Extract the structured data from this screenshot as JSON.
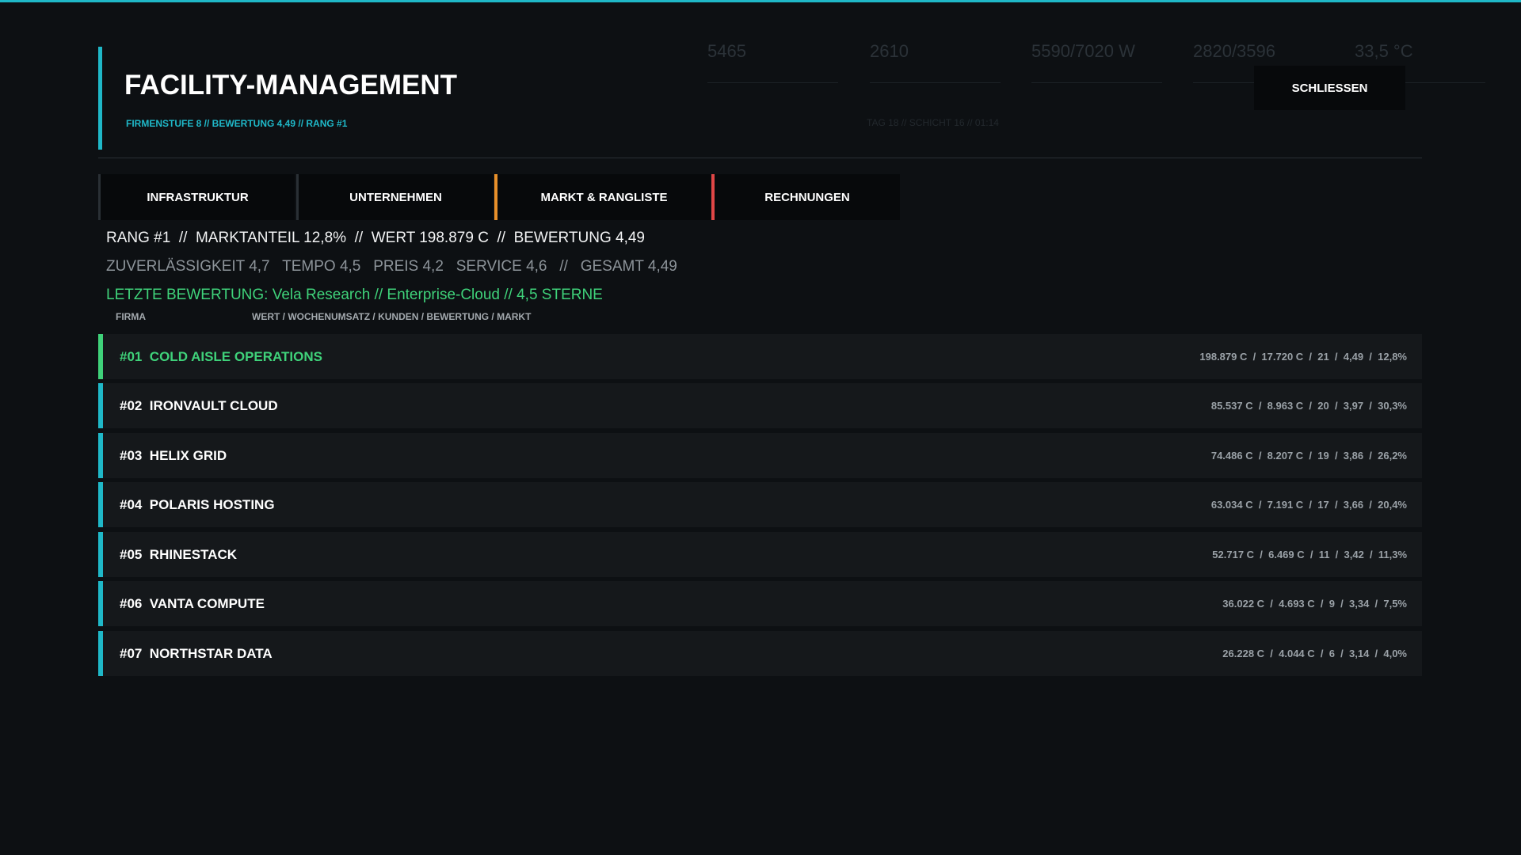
{
  "colors": {
    "accent": "#1fb8c8",
    "top_rank": "#3fd27a",
    "tab_markt": "#e8902a",
    "tab_rechnungen": "#e04646"
  },
  "header": {
    "title": "FACILITY-MANAGEMENT",
    "subtitle": "FIRMENSTUFE 8 // BEWERTUNG 4,49 // RANG #1",
    "close_label": "SCHLIESSEN"
  },
  "background_hud": {
    "values": [
      "5465",
      "2610",
      "5590/7020 W",
      "2820/3596",
      "33,5 °C"
    ],
    "day_line": "TAG 18 // SCHICHT 16 // 01:14"
  },
  "tabs": [
    {
      "label": "INFRASTRUKTUR",
      "icon": "none"
    },
    {
      "label": "UNTERNEHMEN"
    },
    {
      "label": "MARKT & RANGLISTE"
    },
    {
      "label": "RECHNUNGEN"
    }
  ],
  "summary": {
    "line1": "RANG #1  //  MARKTANTEIL 12,8%  //  WERT 198.879 C  //  BEWERTUNG 4,49",
    "line2": "ZUVERLÄSSIGKEIT 4,7   TEMPO 4,5   PREIS 4,2   SERVICE 4,6   //   GESAMT 4,49",
    "line3": "LETZTE BEWERTUNG: Vela Research // Enterprise-Cloud // 4,5 STERNE"
  },
  "columns": {
    "firma": "FIRMA",
    "stats": "WERT / WOCHENUMSATZ / KUNDEN / BEWERTUNG / MARKT"
  },
  "rows": [
    {
      "name": "#01  COLD AISLE OPERATIONS",
      "stats": "198.879 C  /  17.720 C  /  21  /  4,49  /  12,8%"
    },
    {
      "name": "#02  IRONVAULT CLOUD",
      "stats": "85.537 C  /  8.963 C  /  20  /  3,97  /  30,3%"
    },
    {
      "name": "#03  HELIX GRID",
      "stats": "74.486 C  /  8.207 C  /  19  /  3,86  /  26,2%"
    },
    {
      "name": "#04  POLARIS HOSTING",
      "stats": "63.034 C  /  7.191 C  /  17  /  3,66  /  20,4%"
    },
    {
      "name": "#05  RHINESTACK",
      "stats": "52.717 C  /  6.469 C  /  11  /  3,42  /  11,3%"
    },
    {
      "name": "#06  VANTA COMPUTE",
      "stats": "36.022 C  /  4.693 C  /  9  /  3,34  /  7,5%"
    },
    {
      "name": "#07  NORTHSTAR DATA",
      "stats": "26.228 C  /  4.044 C  /  6  /  3,14  /  4,0%"
    }
  ]
}
